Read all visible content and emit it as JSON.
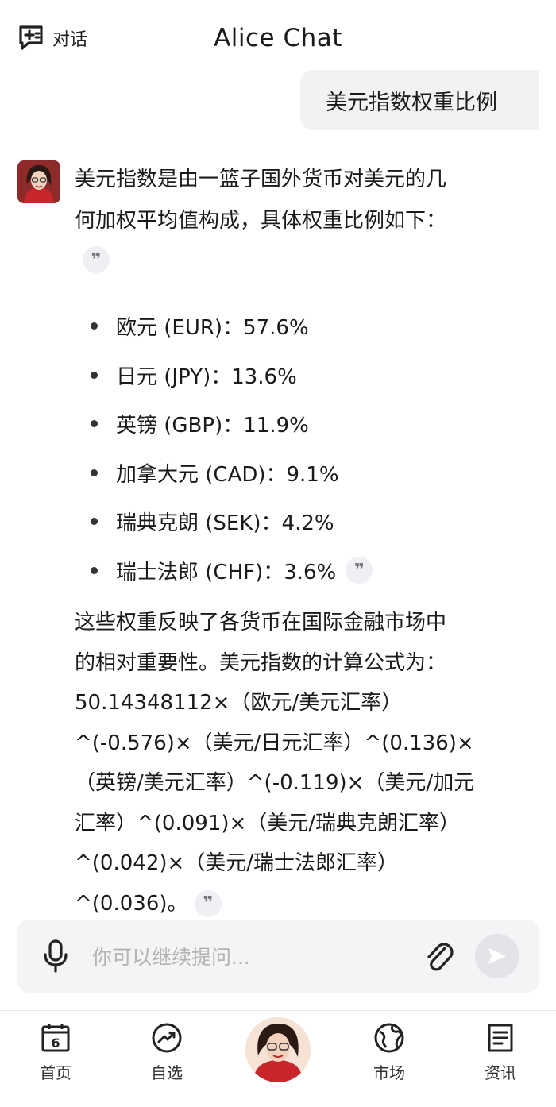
{
  "header": {
    "back_label": "对话",
    "title": "Alice Chat"
  },
  "chat": {
    "user_message": "美元指数权重比例",
    "intro": [
      "美元指数是由一篮子国外货币对美元的几",
      "何加权平均值构成，具体权重比例如下："
    ],
    "quote_glyph": "❞",
    "weights": [
      {
        "label": "欧元 (EUR)：57.6%"
      },
      {
        "label": "日元 (JPY)：13.6%"
      },
      {
        "label": "英镑 (GBP)：11.9%"
      },
      {
        "label": "加拿大元 (CAD)：9.1%"
      },
      {
        "label": "瑞典克朗 (SEK)：4.2%"
      },
      {
        "label": "瑞士法郎 (CHF)：3.6%"
      }
    ],
    "formula_lines": [
      "这些权重反映了各货币在国际金融市场中",
      "的相对重要性。美元指数的计算公式为：",
      "50.14348112×（欧元/美元汇率）",
      "^(-0.576)×（美元/日元汇率）^(0.136)×",
      "（英镑/美元汇率）^(-0.119)×（美元/加元",
      "汇率）^(0.091)×（美元/瑞典克朗汇率）",
      "^(0.042)×（美元/瑞士法郎汇率）",
      "^(0.036)。"
    ]
  },
  "input": {
    "placeholder": "你可以继续提问..."
  },
  "tabbar": {
    "items": [
      {
        "label": "首页",
        "icon": "calendar-icon",
        "badge": "6"
      },
      {
        "label": "自选",
        "icon": "trend-icon"
      },
      {
        "label": "市场",
        "icon": "globe-icon"
      },
      {
        "label": "资讯",
        "icon": "news-icon"
      }
    ]
  },
  "colors": {
    "accent_red": "#c8262b",
    "bubble_bg": "#f1f2f4",
    "input_bg": "#f3f4f6"
  }
}
